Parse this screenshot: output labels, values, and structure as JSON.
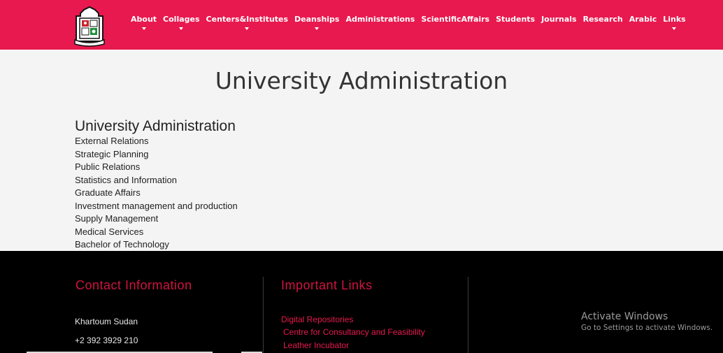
{
  "nav": {
    "items": [
      {
        "label": "About",
        "has_dropdown": true
      },
      {
        "label": "Collages",
        "has_dropdown": true
      },
      {
        "label": "Centers&Institutes",
        "has_dropdown": true
      },
      {
        "label": "Deanships",
        "has_dropdown": true
      },
      {
        "label": "Administrations",
        "has_dropdown": false
      },
      {
        "label": "ScientificAffairs",
        "has_dropdown": false
      },
      {
        "label": "Students",
        "has_dropdown": false
      },
      {
        "label": "Journals",
        "has_dropdown": false
      },
      {
        "label": "Research",
        "has_dropdown": false
      },
      {
        "label": "Arabic",
        "has_dropdown": false
      },
      {
        "label": "Links",
        "has_dropdown": true
      }
    ],
    "logo_icon": "university-crest-icon"
  },
  "main": {
    "title": "University Administration",
    "section_heading": "University Administration",
    "links": [
      "External Relations",
      "Strategic Planning",
      "Public Relations",
      "Statistics and Information",
      "Graduate Affairs",
      "Investment management and production",
      "Supply Management",
      "Medical Services",
      "Bachelor of Technology"
    ]
  },
  "footer": {
    "contact_title": "Contact Information",
    "address": "Khartoum Sudan",
    "phone": "+2 392 3929 210",
    "links_title": "Important Links",
    "links": [
      "Digital Repositories",
      "Centre for Consultancy and Feasibility",
      "Leather Incubator"
    ]
  },
  "os_overlay": {
    "line1": "Activate Windows",
    "line2": "Go to Settings to activate Windows."
  },
  "colors": {
    "brand": "#e8194f",
    "footer_bg": "#000000",
    "footer_heading": "#d0143f"
  }
}
